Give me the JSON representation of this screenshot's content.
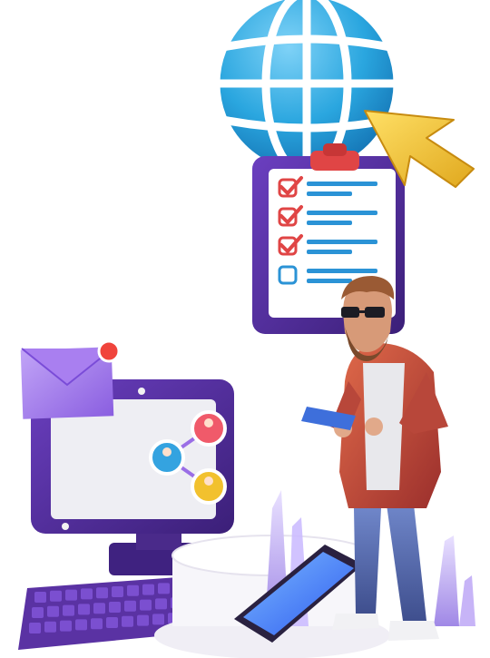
{
  "illustration": {
    "globe": {
      "icon": "globe-icon",
      "color": "#2aa6df"
    },
    "cursor": {
      "icon": "cursor-arrow-icon",
      "color": "#f2c12e"
    },
    "clipboard": {
      "icon": "checklist-clipboard-icon",
      "frame_color": "#4a2a8a",
      "items": [
        {
          "checked": true
        },
        {
          "checked": true
        },
        {
          "checked": true
        },
        {
          "checked": false
        }
      ]
    },
    "envelope": {
      "icon": "envelope-icon",
      "color": "#9a6ee6",
      "has_notification": true
    },
    "monitor": {
      "icon": "monitor-icon",
      "frame_color": "#4a2a8a",
      "network_nodes": 3
    },
    "keyboard": {
      "icon": "keyboard-icon",
      "color": "#5a32a3"
    },
    "phone": {
      "icon": "smartphone-icon",
      "screen_color": "#4a7bff"
    },
    "person": {
      "icon": "man-reading-tablet-figure",
      "jacket_color": "#c8453a"
    },
    "crystals": {
      "icon": "crystal-shards-icon",
      "color": "#b9a2f2"
    }
  }
}
